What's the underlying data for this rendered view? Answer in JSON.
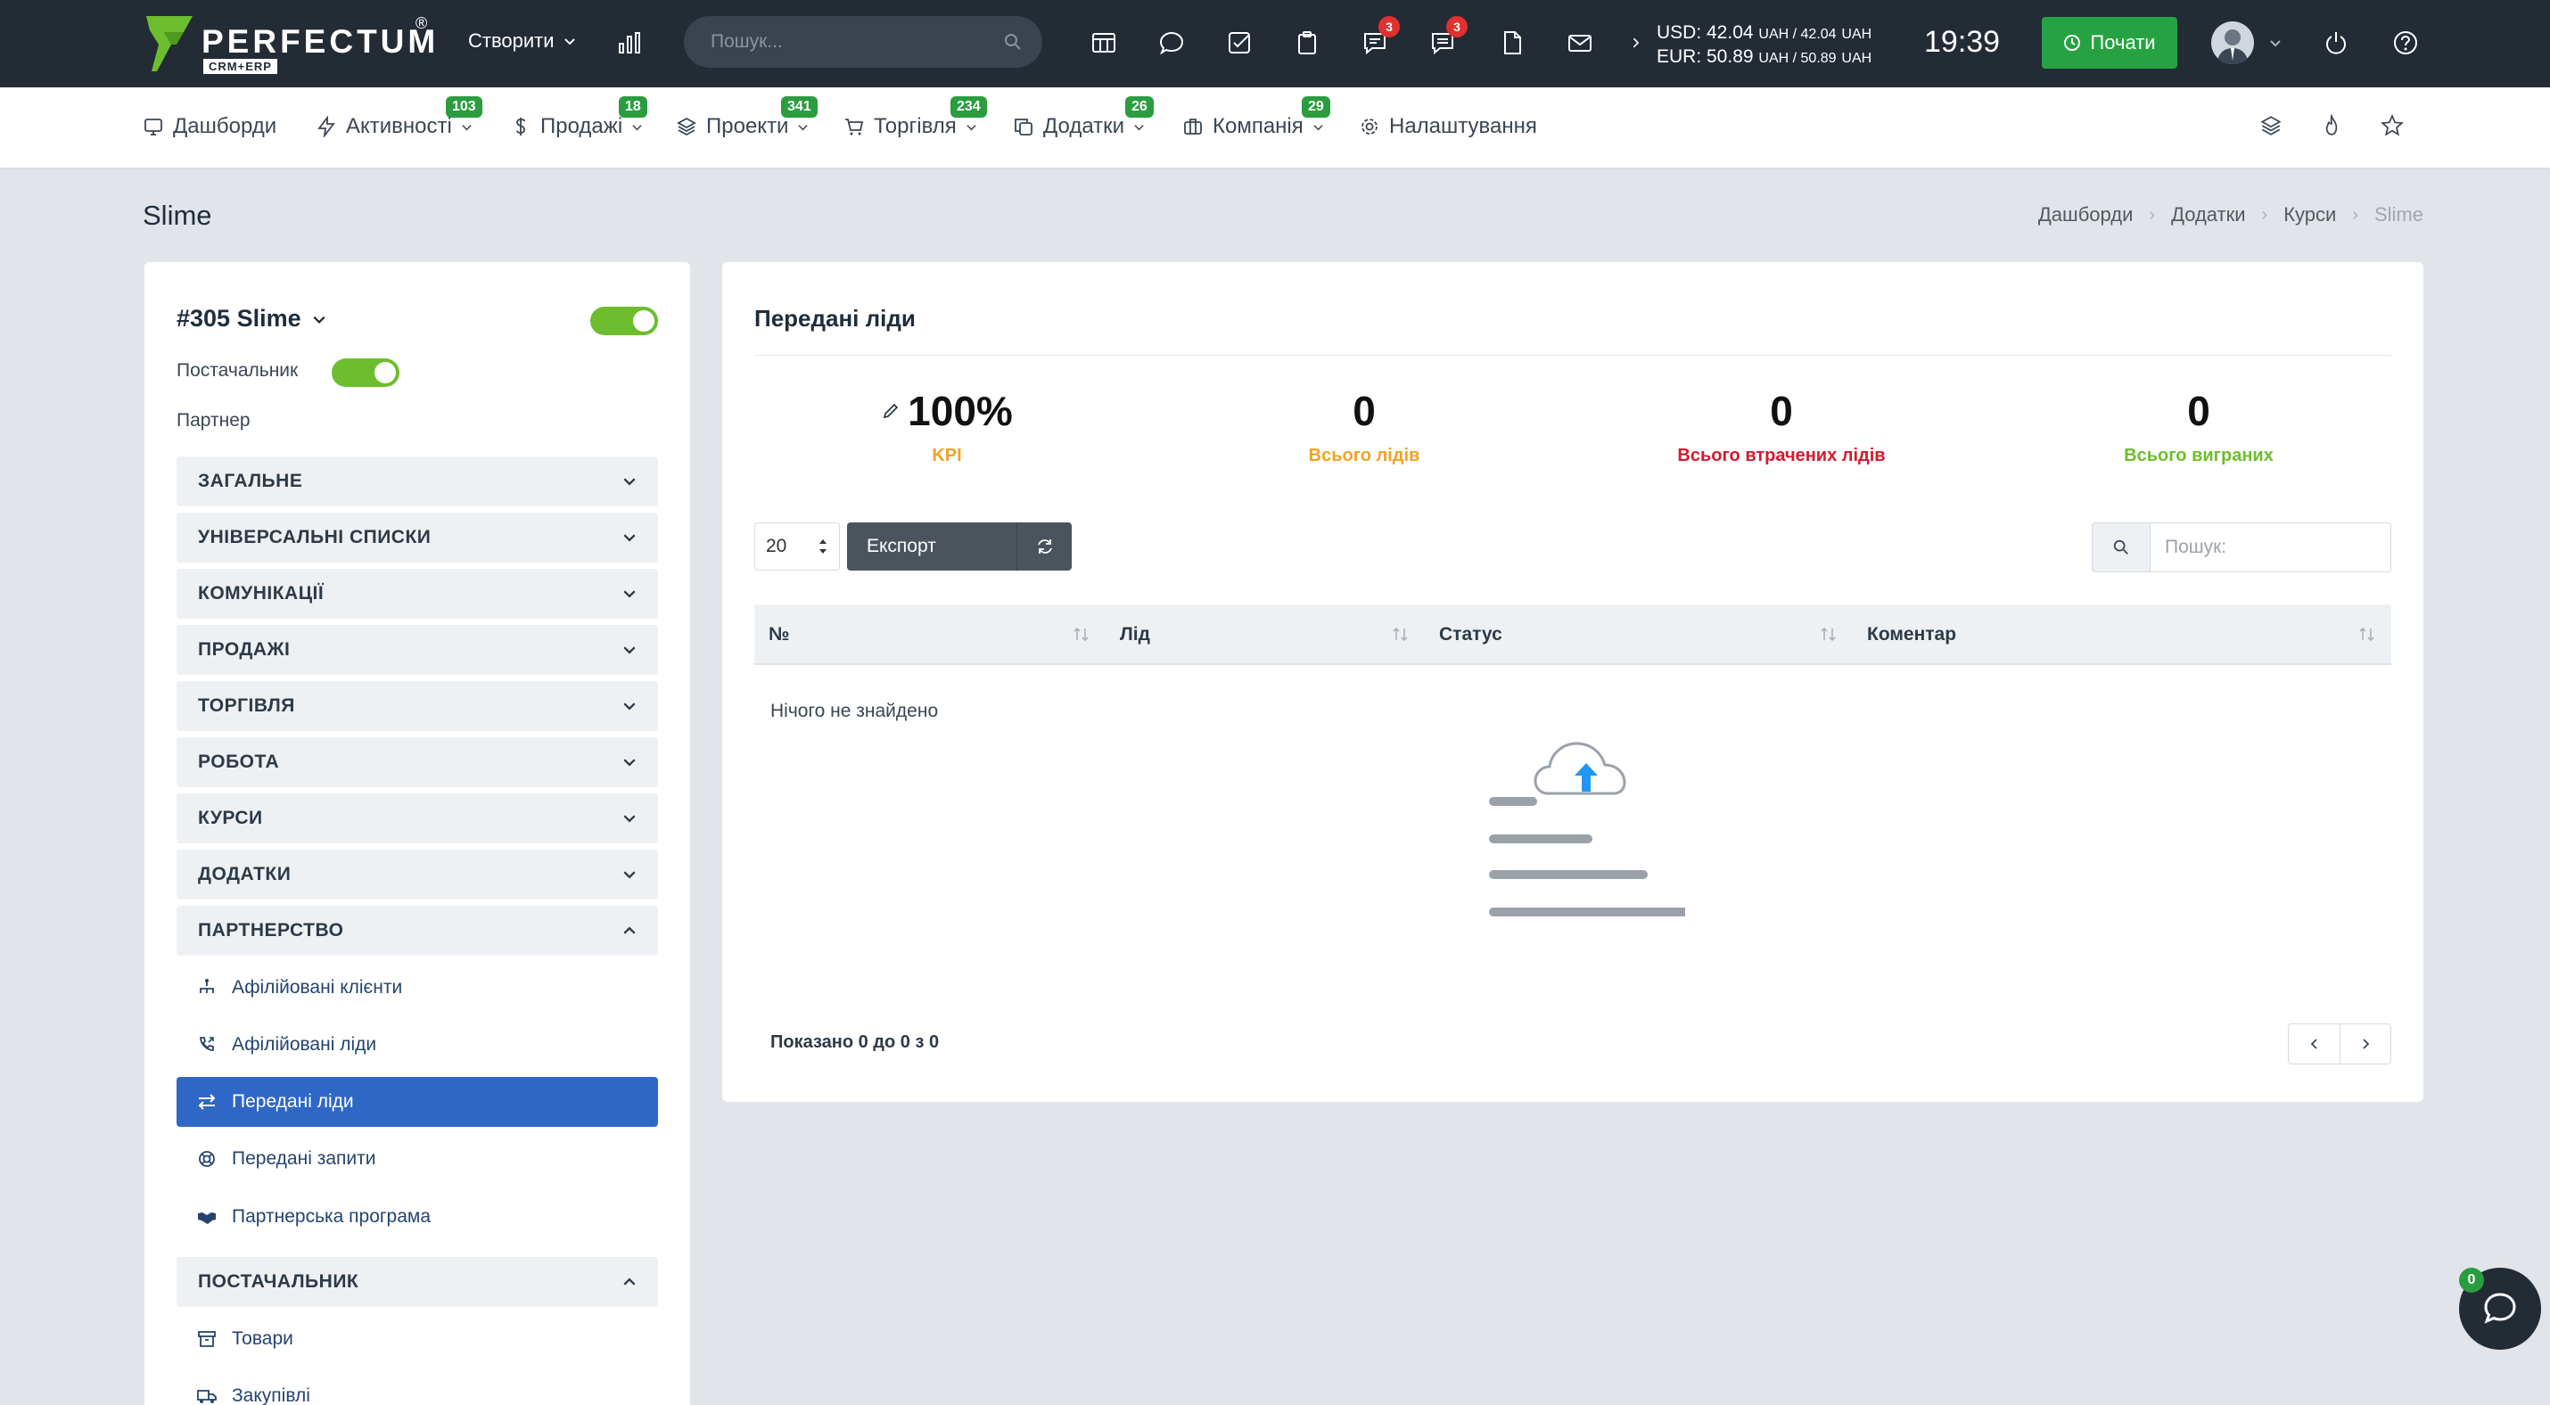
{
  "topbar": {
    "logo_text": "PERFECTUM",
    "logo_sub": "CRM+ERP",
    "logo_reg": "®",
    "create_label": "Створити",
    "search_placeholder": "Пошук...",
    "chat_badge": "3",
    "messages_badge": "3",
    "usd_line": "USD: 42.04",
    "usd_line_tail": "UAH / 42.04",
    "usd_unit": "UAH",
    "eur_line": "EUR: 50.89",
    "eur_line_tail": "UAH / 50.89",
    "eur_unit": "UAH",
    "time": "19:39",
    "start_label": "Почати"
  },
  "nav": {
    "items": [
      {
        "label": "Дашборди",
        "icon": "monitor-icon"
      },
      {
        "label": "Активності",
        "badge": "103",
        "icon": "bolt-icon"
      },
      {
        "label": "Продажі",
        "badge": "18",
        "icon": "dollar-icon"
      },
      {
        "label": "Проекти",
        "badge": "341",
        "icon": "layers-icon"
      },
      {
        "label": "Торгівля",
        "badge": "234",
        "icon": "cart-icon"
      },
      {
        "label": "Додатки",
        "badge": "26",
        "icon": "copy-icon"
      },
      {
        "label": "Компанія",
        "badge": "29",
        "icon": "briefcase-icon"
      },
      {
        "label": "Налаштування",
        "icon": "gear-icon"
      }
    ]
  },
  "page": {
    "title": "Slime",
    "breadcrumb": [
      "Дашборди",
      "Додатки",
      "Курси",
      "Slime"
    ]
  },
  "sidebar": {
    "entity_title": "#305 Slime",
    "supplier_label": "Постачальник",
    "partner_label": "Партнер",
    "sections": [
      "ЗАГАЛЬНЕ",
      "УНІВЕРСАЛЬНІ СПИСКИ",
      "КОМУНІКАЦІЇ",
      "ПРОДАЖІ",
      "ТОРГІВЛЯ",
      "РОБОТА",
      "КУРСИ",
      "ДОДАТКИ",
      "ПАРТНЕРСТВО"
    ],
    "partner_items": [
      "Афілійовані клієнти",
      "Афілійовані ліди",
      "Передані ліди",
      "Передані запити",
      "Партнерська програма"
    ],
    "supplier_section": "ПОСТАЧАЛЬНИК",
    "supplier_items": [
      "Товари",
      "Закупівлі"
    ]
  },
  "main": {
    "title": "Передані ліди",
    "kpis": [
      {
        "value": "100%",
        "caption": "KPI",
        "color": "#f0a323"
      },
      {
        "value": "0",
        "caption": "Всього лідів",
        "color": "#f0a323"
      },
      {
        "value": "0",
        "caption": "Всього втрачених лідів",
        "color": "#d9182d"
      },
      {
        "value": "0",
        "caption": "Всього виграних",
        "color": "#6cbe2e"
      }
    ],
    "page_length": "20",
    "export_label": "Експорт",
    "search_placeholder": "Пошук:",
    "columns": [
      "№",
      "Лід",
      "Статус",
      "Коментар"
    ],
    "empty_text": "Нічого не знайдено",
    "shown_text": "Показано 0 до 0 з 0"
  },
  "chat_widget": {
    "badge": "0"
  },
  "colors": {
    "accent_green": "#27a243",
    "active_blue": "#2f67c6",
    "topbar": "#232b35"
  }
}
